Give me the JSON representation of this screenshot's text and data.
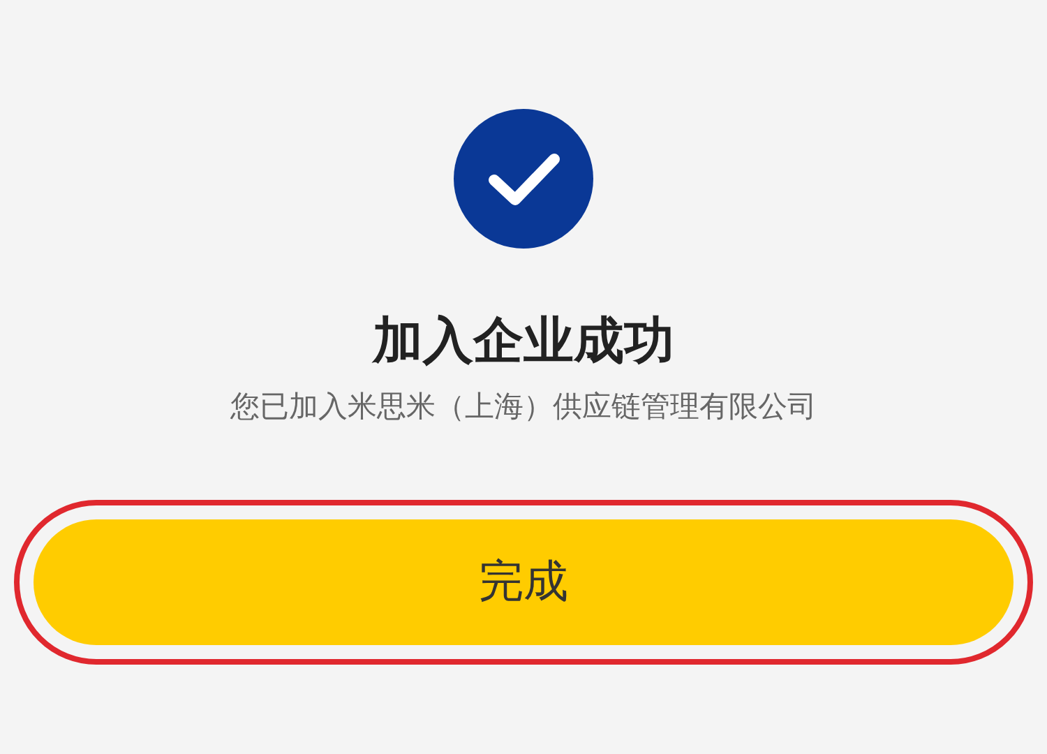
{
  "title": "加入企业成功",
  "message": "您已加入米思米（上海）供应链管理有限公司",
  "button": {
    "label": "完成",
    "highlighted": true
  }
}
